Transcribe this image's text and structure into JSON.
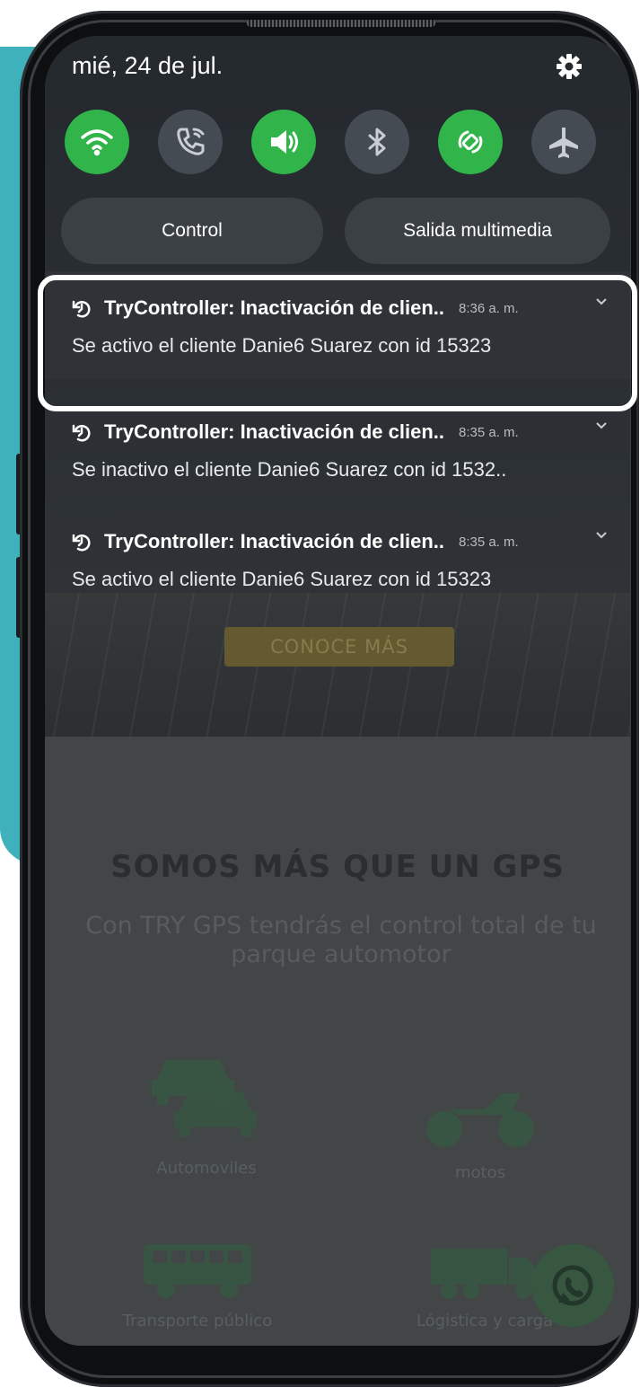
{
  "status": {
    "date": "mié, 24 de jul."
  },
  "quick_settings": [
    {
      "icon": "wifi-icon",
      "state": "on"
    },
    {
      "icon": "wifi-calling-icon",
      "state": "off"
    },
    {
      "icon": "sound-icon",
      "state": "on"
    },
    {
      "icon": "bluetooth-icon",
      "state": "off"
    },
    {
      "icon": "auto-rotate-icon",
      "state": "on"
    },
    {
      "icon": "airplane-icon",
      "state": "off"
    }
  ],
  "buttons": {
    "control": "Control",
    "media_output": "Salida multimedia"
  },
  "notifications": [
    {
      "title": "TryController: Inactivación de clien..",
      "time": "8:36 a. m.",
      "body": "Se activo el cliente Danie6 Suarez con id 15323"
    },
    {
      "title": "TryController: Inactivación de clien..",
      "time": "8:35 a. m.",
      "body": "Se inactivo el cliente Danie6 Suarez con id 1532.."
    },
    {
      "title": "TryController: Inactivación de clien..",
      "time": "8:35 a. m.",
      "body": "Se activo el cliente Danie6 Suarez con id 15323"
    }
  ],
  "website": {
    "cta": "CONOCE MÁS",
    "heading": "SOMOS MÁS QUE UN GPS",
    "subheading": "Con TRY GPS tendrás el control total de tu parque automotor",
    "services": [
      "Automoviles",
      "motos",
      "Transporte público",
      "Lógistica y carga"
    ]
  },
  "colors": {
    "accent_teal": "#3fb1bb",
    "toggle_on": "#31b44a",
    "toggle_off": "#444b52"
  }
}
